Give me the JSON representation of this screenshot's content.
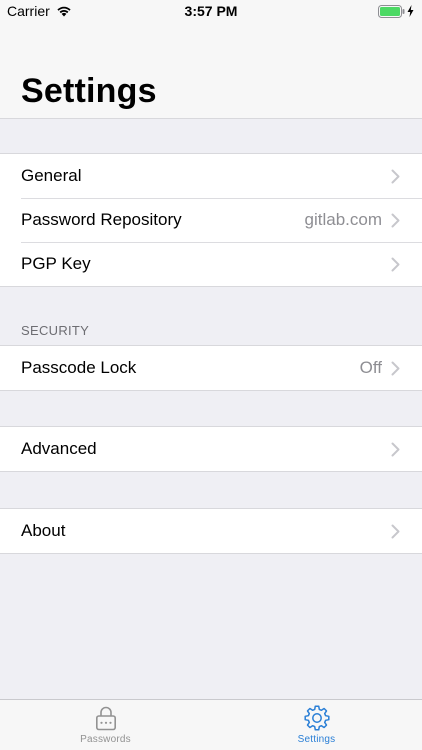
{
  "status_bar": {
    "carrier": "Carrier",
    "time": "3:57 PM",
    "wifi_icon": "wifi-icon",
    "battery_icon": "battery-icon",
    "battery_color": "#4cd964"
  },
  "header": {
    "title": "Settings"
  },
  "groups": {
    "main": {
      "items": [
        {
          "label": "General",
          "detail": ""
        },
        {
          "label": "Password Repository",
          "detail": "gitlab.com"
        },
        {
          "label": "PGP Key",
          "detail": ""
        }
      ]
    },
    "security": {
      "header": "SECURITY",
      "items": [
        {
          "label": "Passcode Lock",
          "detail": "Off"
        }
      ]
    },
    "advanced": {
      "items": [
        {
          "label": "Advanced",
          "detail": ""
        }
      ]
    },
    "about": {
      "items": [
        {
          "label": "About",
          "detail": ""
        }
      ]
    }
  },
  "tab_bar": {
    "tabs": [
      {
        "label": "Passwords",
        "icon": "lock-icon",
        "active": false
      },
      {
        "label": "Settings",
        "icon": "gear-icon",
        "active": true
      }
    ],
    "active_color": "#2a7fd6",
    "inactive_color": "#929292"
  }
}
